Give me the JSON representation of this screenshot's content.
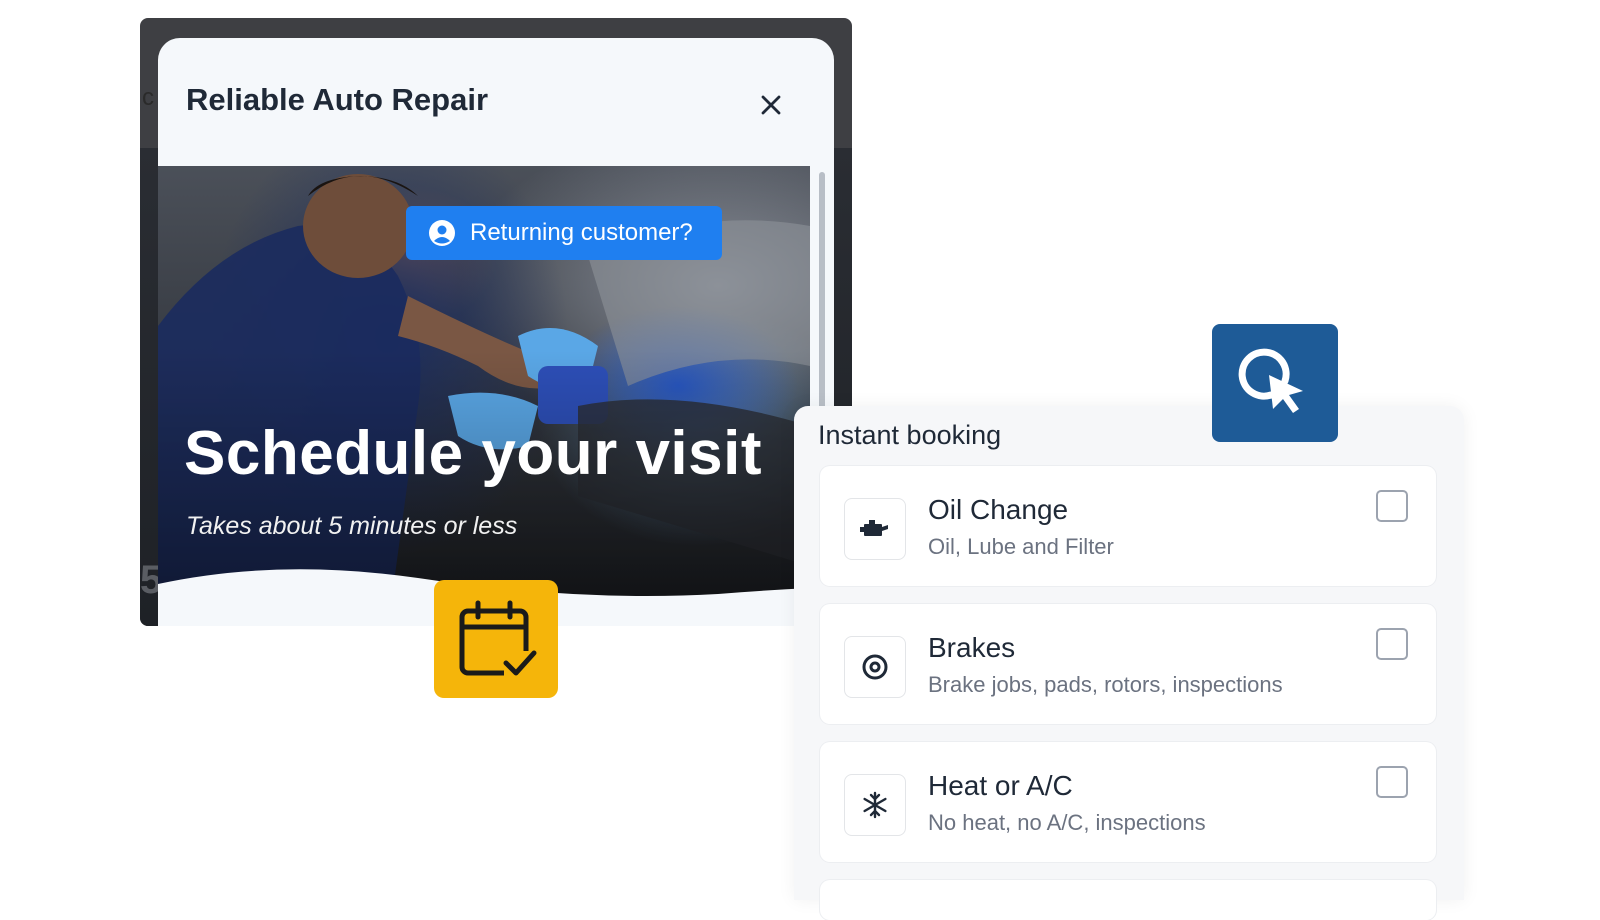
{
  "modal": {
    "title": "Reliable Auto Repair",
    "close_icon": "close-icon"
  },
  "hero": {
    "returning_label": "Returning customer?",
    "returning_icon": "user-circle-icon",
    "title": "Schedule your visit",
    "subtitle": "Takes about 5 minutes or less"
  },
  "backdrop": {
    "partial_letter": "c",
    "partial_digit": "5"
  },
  "badges": {
    "calendar_icon": "calendar-check-icon",
    "cursor_icon": "cursor-click-icon"
  },
  "booking": {
    "title": "Instant booking",
    "services": [
      {
        "name": "Oil Change",
        "description": "Oil, Lube and Filter",
        "icon": "oil-can-icon",
        "checked": false
      },
      {
        "name": "Brakes",
        "description": "Brake jobs, pads, rotors, inspections",
        "icon": "brake-disc-icon",
        "checked": false
      },
      {
        "name": "Heat or A/C",
        "description": "No heat, no A/C, inspections",
        "icon": "snowflake-icon",
        "checked": false
      }
    ]
  },
  "colors": {
    "accent_blue": "#1f7ff0",
    "badge_yellow": "#f5b50a",
    "badge_navy": "#1e5b97"
  }
}
